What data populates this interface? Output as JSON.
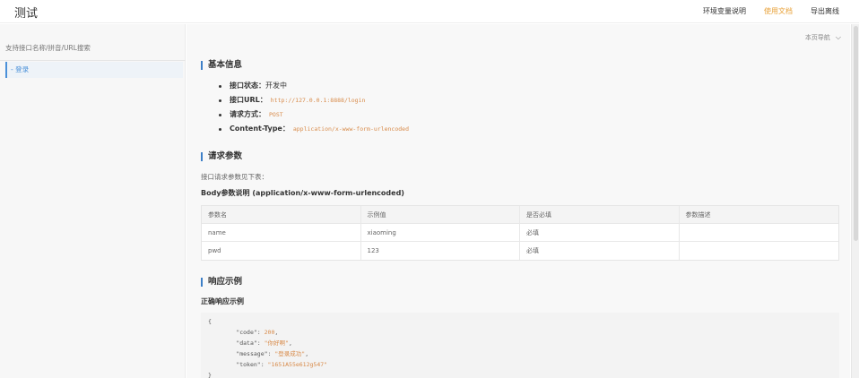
{
  "app": {
    "title": "测试"
  },
  "topnav": {
    "env": "环境变量说明",
    "docs": "使用文档",
    "export": "导出离线"
  },
  "sidebar": {
    "search_placeholder": "支持接口名称/拼音/URL搜索",
    "items": [
      {
        "label": "- 登录"
      }
    ]
  },
  "toc": {
    "label": "本页导航"
  },
  "basic": {
    "title": "基本信息",
    "status_key": "接口状态：",
    "status_value": "开发中",
    "url_key": "接口URL：",
    "url_value": "http://127.0.0.1:8888/login",
    "method_key": "请求方式：",
    "method_value": "POST",
    "ctype_key": "Content-Type：",
    "ctype_value": "application/x-www-form-urlencoded"
  },
  "params": {
    "title": "请求参数",
    "note": "接口请求参数见下表：",
    "body_title": "Body参数说明 (application/x-www-form-urlencoded)",
    "columns": [
      "参数名",
      "示例值",
      "是否必填",
      "参数描述"
    ],
    "rows": [
      [
        "name",
        "xiaoming",
        "必填",
        ""
      ],
      [
        "pwd",
        "123",
        "必填",
        ""
      ]
    ]
  },
  "response": {
    "title": "响应示例",
    "sub": "正确响应示例",
    "open": "{",
    "k_code": "\"code\"",
    "v_code": "200",
    "k_data": "\"data\"",
    "v_data": "\"你好啊\"",
    "k_message": "\"message\"",
    "v_message": "\"登录成功\"",
    "k_token": "\"token\"",
    "v_token": "\"1651A55e612g547\"",
    "close": "}"
  }
}
